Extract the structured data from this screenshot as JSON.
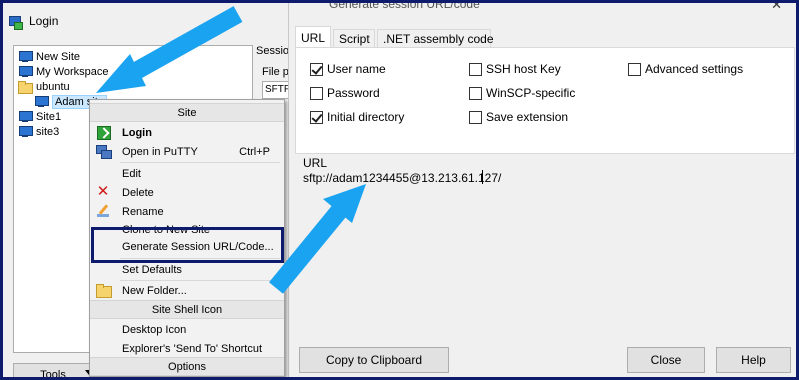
{
  "login_window": {
    "title": "Login",
    "tree": [
      {
        "label": "New Site",
        "icon": "pc-icon"
      },
      {
        "label": "My Workspace",
        "icon": "pc-icon"
      },
      {
        "label": "ubuntu",
        "icon": "folder-icon"
      },
      {
        "label": "Adam site",
        "icon": "pc-icon",
        "selected": true
      },
      {
        "label": "Site1",
        "icon": "pc-icon"
      },
      {
        "label": "site3",
        "icon": "pc-icon"
      }
    ],
    "session_label": "Session",
    "file_label": "File p",
    "file_value": "SFTP",
    "tools_label": "Tools"
  },
  "context_menu": {
    "header_site": "Site",
    "items": [
      {
        "label": "Login",
        "icon": "login-icon",
        "bold": true,
        "shortcut": ""
      },
      {
        "label": "Open in PuTTY",
        "icon": "putty-icon",
        "shortcut": "Ctrl+P"
      },
      {
        "label": "Edit",
        "icon": "",
        "shortcut": ""
      },
      {
        "label": "Delete",
        "icon": "delete-icon",
        "shortcut": ""
      },
      {
        "label": "Rename",
        "icon": "rename-icon",
        "shortcut": ""
      },
      {
        "label": "Clone to New Site",
        "icon": "",
        "shortcut": ""
      },
      {
        "label": "Generate Session URL/Code...",
        "icon": "",
        "shortcut": "",
        "highlighted": true
      },
      {
        "label": "Set Defaults",
        "icon": "",
        "shortcut": ""
      },
      {
        "label": "New Folder...",
        "icon": "folder-icon",
        "shortcut": ""
      }
    ],
    "header_shell": "Site Shell Icon",
    "shell_items": [
      {
        "label": "Desktop Icon"
      },
      {
        "label": "Explorer's 'Send To' Shortcut"
      }
    ],
    "header_options": "Options"
  },
  "dialog": {
    "title": "Generate session URL/code",
    "tabs": [
      "URL",
      "Script",
      ".NET assembly code"
    ],
    "active_tab": "URL",
    "checkboxes": [
      {
        "label": "User name",
        "checked": true
      },
      {
        "label": "Password",
        "checked": false
      },
      {
        "label": "Initial directory",
        "checked": true
      },
      {
        "label": "SSH host Key",
        "checked": false
      },
      {
        "label": "WinSCP-specific",
        "checked": false
      },
      {
        "label": "Save extension",
        "checked": false
      },
      {
        "label": "Advanced settings",
        "checked": false
      }
    ],
    "url_label": "URL",
    "url_value": "sftp://adam1234455@13.213.61.127/",
    "buttons": {
      "copy": "Copy to Clipboard",
      "close": "Close",
      "help": "Help"
    }
  },
  "annotation_colors": {
    "arrow": "#1aa3f0",
    "frame": "#0e1a6b"
  }
}
